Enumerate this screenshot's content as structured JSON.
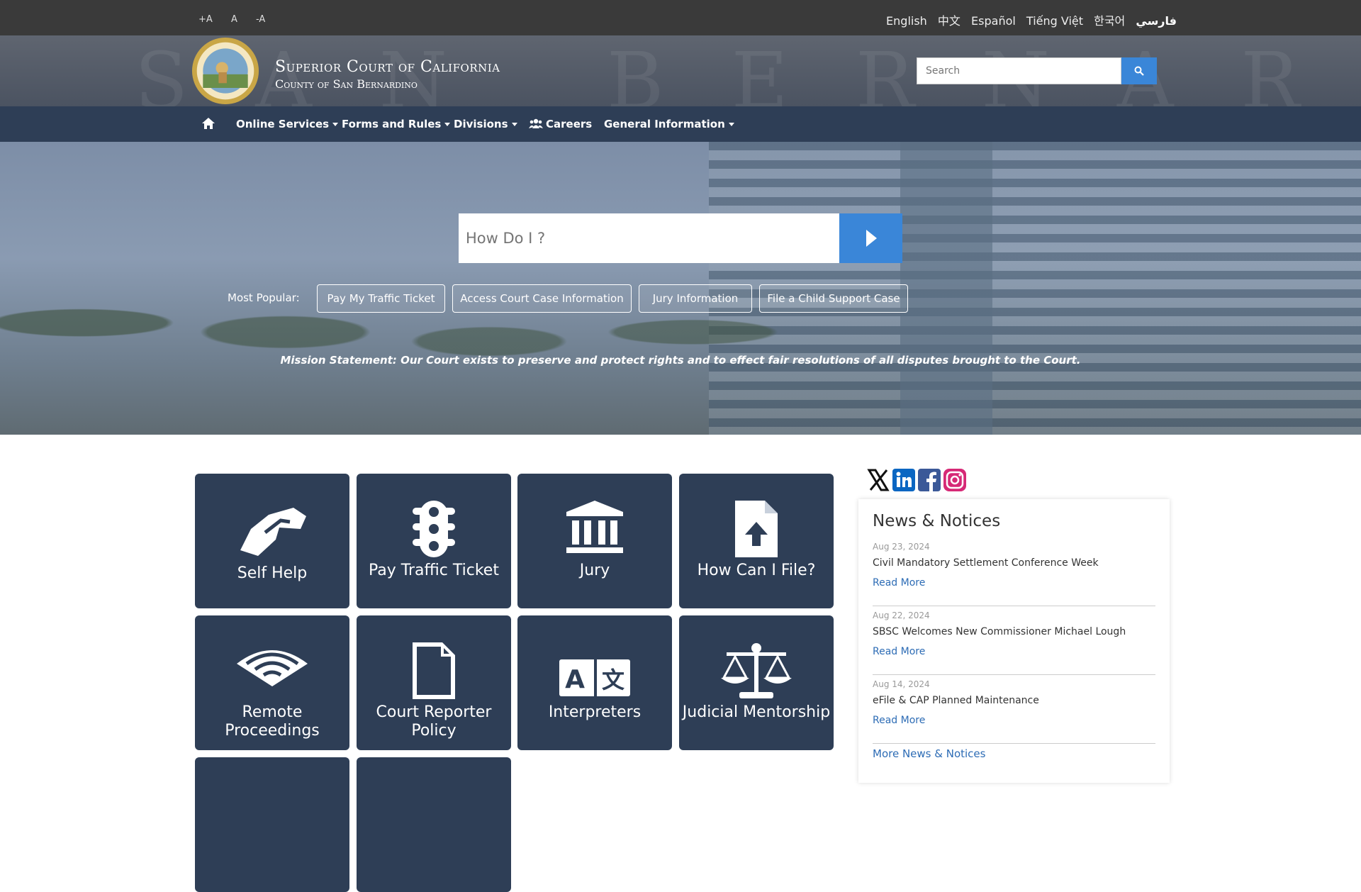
{
  "fontsize": {
    "increase": "+A",
    "normal": "A",
    "decrease": "-A"
  },
  "languages": [
    "English",
    "中文",
    "Español",
    "Tiếng Việt",
    "한국어",
    "فارسي"
  ],
  "header": {
    "title": "Superior Court of California",
    "subtitle": "County of San Bernardino",
    "search_placeholder": "Search"
  },
  "nav": {
    "home_icon": "home-icon",
    "items": [
      "Online Services",
      "Forms and Rules",
      "Divisions",
      "Careers",
      "General Information"
    ]
  },
  "hero": {
    "howdoi_placeholder": "How Do I ?",
    "most_popular_label": "Most Popular:",
    "popular": [
      "Pay My Traffic Ticket",
      "Access Court Case Information",
      "Jury Information",
      "File a Child Support Case"
    ],
    "mission": "Mission Statement: Our Court exists to preserve and protect rights and to effect fair resolutions of all disputes brought to the Court."
  },
  "tiles": [
    {
      "label": "Self Help",
      "icon": "handshake-icon"
    },
    {
      "label": "Pay Traffic Ticket",
      "icon": "traffic-light-icon"
    },
    {
      "label": "Jury",
      "icon": "courthouse-icon"
    },
    {
      "label": "How Can I File?",
      "icon": "file-upload-icon"
    },
    {
      "label": "Remote Proceedings",
      "icon": "wifi-icon"
    },
    {
      "label": "Court Reporter Policy",
      "icon": "document-icon"
    },
    {
      "label": "Interpreters",
      "icon": "language-icon"
    },
    {
      "label": "Judicial Mentorship",
      "icon": "scales-icon"
    }
  ],
  "social": [
    "x-icon",
    "linkedin-icon",
    "facebook-icon",
    "instagram-icon"
  ],
  "news": {
    "heading": "News & Notices",
    "items": [
      {
        "date": "Aug 23, 2024",
        "title": "Civil Mandatory Settlement Conference Week",
        "link": "Read More"
      },
      {
        "date": "Aug 22, 2024",
        "title": "SBSC Welcomes New Commissioner Michael Lough",
        "link": "Read More"
      },
      {
        "date": "Aug 14, 2024",
        "title": "eFile & CAP Planned Maintenance",
        "link": "Read More"
      }
    ],
    "more": "More News & Notices"
  },
  "colors": {
    "navy": "#2e3e56",
    "accent": "#3a86d8",
    "link": "#2d6cb5"
  }
}
